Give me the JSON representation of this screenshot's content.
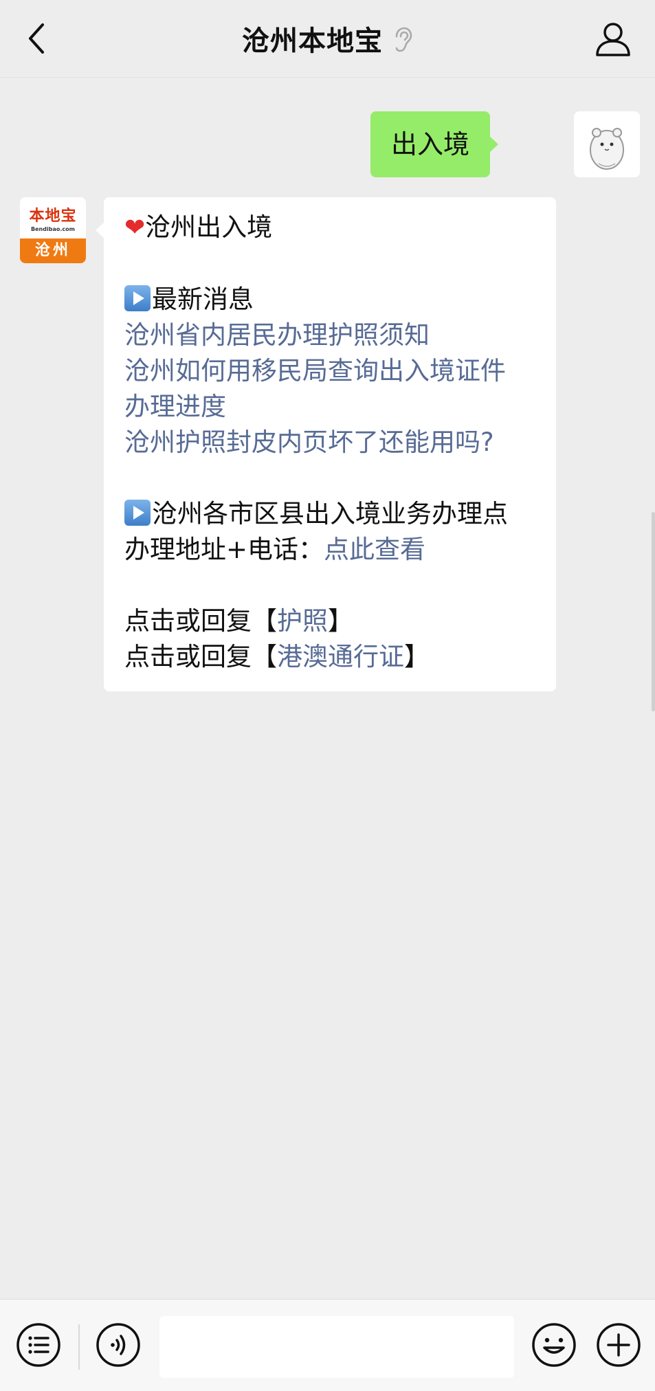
{
  "header": {
    "title": "沧州本地宝"
  },
  "conversation": {
    "user_message": "出入境",
    "bot_avatar": {
      "logo_text": "本地宝",
      "domain": "Bendibao.com",
      "city": "沧州"
    },
    "reply": {
      "heading": "沧州出入境",
      "section1_title": "最新消息",
      "link1": "沧州省内居民办理护照须知",
      "link2_line1": "沧州如何用移民局查询出入境证件",
      "link2_line2": "办理进度",
      "link3": "沧州护照封皮内页坏了还能用吗?",
      "section2_title": "沧州各市区县出入境业务办理点",
      "address_prefix": "办理地址+电话：",
      "address_link": "点此查看",
      "reply_prefix": "点击或回复【",
      "reply_suffix": "】",
      "passport_link": "护照",
      "hk_macau_link": "港澳通行证"
    }
  },
  "input": {
    "value": ""
  },
  "icons": {
    "back": "chevron-left-icon",
    "ear": "ear-icon",
    "profile": "person-icon",
    "menu": "list-icon",
    "voice": "voice-icon",
    "emoji": "emoji-icon",
    "add": "plus-icon"
  },
  "colors": {
    "outgoing_bubble": "#95ec69",
    "link": "#576b95",
    "background": "#ededed"
  }
}
